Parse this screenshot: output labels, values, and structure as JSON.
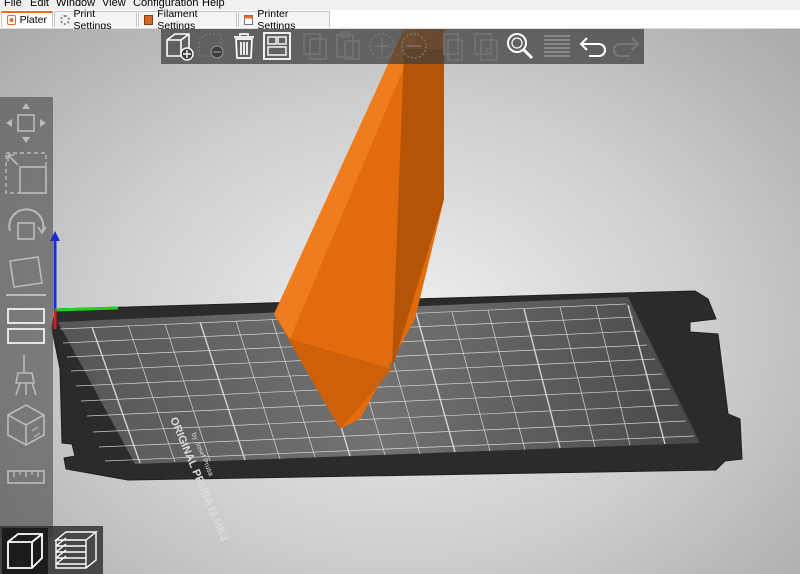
{
  "menu": [
    "File",
    "Edit",
    "Window",
    "View",
    "Configuration",
    "Help"
  ],
  "tabs": [
    {
      "label": "Plater",
      "active": true
    },
    {
      "label": "Print Settings",
      "active": false
    },
    {
      "label": "Filament Settings",
      "active": false
    },
    {
      "label": "Printer Settings",
      "active": false
    }
  ],
  "toolbar": [
    "add-object",
    "delete",
    "delete-all",
    "arrange",
    "copy",
    "paste",
    "add-instance",
    "remove-instance",
    "split-objects",
    "split-parts",
    "search",
    "layers-editing",
    "undo",
    "redo"
  ],
  "left_toolbar": [
    "move",
    "scale",
    "rotate",
    "place-on-face",
    "cut",
    "paint-supports",
    "seam",
    "hollow",
    "measure"
  ],
  "bed_label": {
    "line1": "ORIGINAL PRUSA i3 MK3",
    "line2": "by Josef Prusa"
  },
  "colors": {
    "accent": "#ed6b21",
    "object": "#e56f0c",
    "bed": "#2e2e2e",
    "toolbar_bg": "#3c3c3c"
  }
}
